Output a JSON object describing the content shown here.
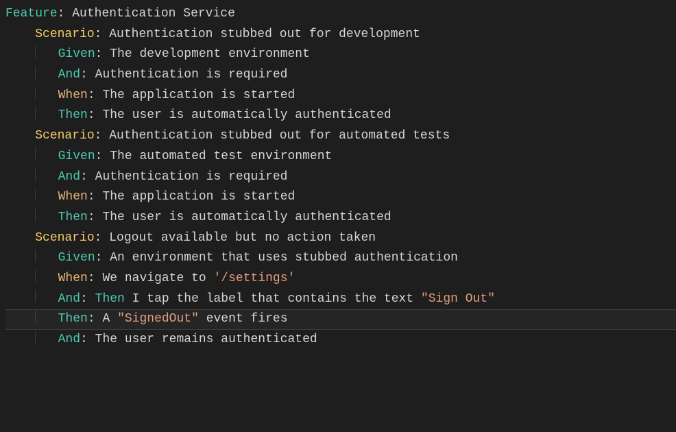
{
  "keywords": {
    "feature": "Feature",
    "scenario": "Scenario",
    "given": "Given",
    "and": "And",
    "when": "When",
    "then": "Then"
  },
  "feature_title": "Authentication Service",
  "scenarios": [
    {
      "title": "Authentication stubbed out for development",
      "steps": [
        {
          "kw": "given",
          "text": "The development environment"
        },
        {
          "kw": "and",
          "text": "Authentication is required"
        },
        {
          "kw": "when",
          "text": "The application is started"
        },
        {
          "kw": "then",
          "text": "The user is automatically authenticated"
        }
      ]
    },
    {
      "title": "Authentication stubbed out for automated tests",
      "steps": [
        {
          "kw": "given",
          "text": "The automated test environment"
        },
        {
          "kw": "and",
          "text": "Authentication is required"
        },
        {
          "kw": "when",
          "text": "The application is started"
        },
        {
          "kw": "then",
          "text": "The user is automatically authenticated"
        }
      ]
    },
    {
      "title": "Logout available but no action taken",
      "steps": [
        {
          "kw": "given",
          "text": "An environment that uses stubbed authentication"
        },
        {
          "kw": "when",
          "text_parts": [
            "We navigate to ",
            "'/settings'"
          ],
          "string_index": 1
        },
        {
          "kw": "and",
          "prefixThenKw": true,
          "text_parts": [
            " I tap the label that contains the text ",
            "\"Sign Out\""
          ],
          "string_index": 1
        },
        {
          "kw": "then",
          "text_parts": [
            "A ",
            "\"SignedOut\"",
            " event fires"
          ],
          "string_index": 1,
          "highlight": true
        },
        {
          "kw": "and",
          "text": "The user remains authenticated"
        }
      ]
    }
  ]
}
